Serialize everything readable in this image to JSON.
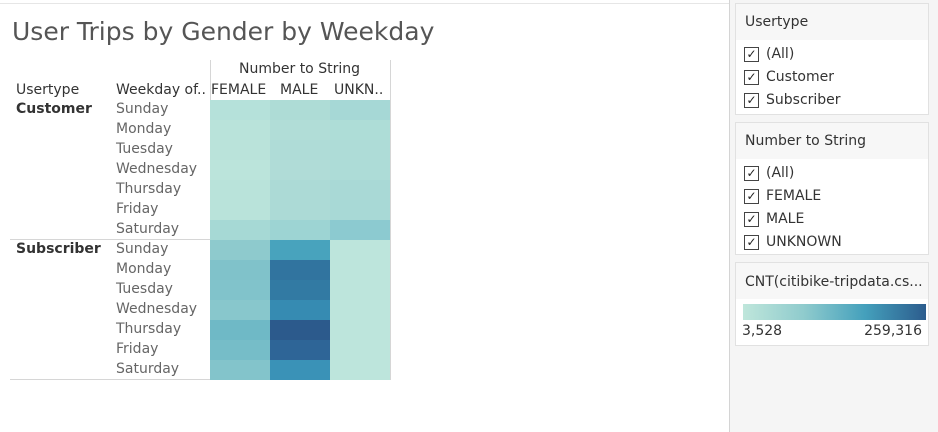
{
  "title": "User Trips by Gender by Weekday",
  "headers": {
    "usertype": "Usertype",
    "weekday": "Weekday of..",
    "number_to_string": "Number to String",
    "columns": [
      "FEMALE",
      "MALE",
      "UNKN.."
    ]
  },
  "groups": [
    {
      "label": "Customer",
      "days": [
        "Sunday",
        "Monday",
        "Tuesday",
        "Wednesday",
        "Thursday",
        "Friday",
        "Saturday"
      ],
      "colors": [
        [
          "#b5e1da",
          "#aedcd6",
          "#a6d8d6"
        ],
        [
          "#b9e3da",
          "#b1ddd7",
          "#aeddd7"
        ],
        [
          "#bae3da",
          "#afdcd7",
          "#aedcd7"
        ],
        [
          "#bbe4db",
          "#b0dcd7",
          "#addcd7"
        ],
        [
          "#b9e3da",
          "#acdad6",
          "#a9d9d6"
        ],
        [
          "#b9e3da",
          "#acdad6",
          "#a8d9d6"
        ],
        [
          "#a6d9d5",
          "#9dd4d3",
          "#8ccad0"
        ]
      ]
    },
    {
      "label": "Subscriber",
      "days": [
        "Sunday",
        "Monday",
        "Tuesday",
        "Wednesday",
        "Thursday",
        "Friday",
        "Saturday"
      ],
      "colors": [
        [
          "#8ecacd",
          "#48a3bd",
          "#bde5dc"
        ],
        [
          "#80c2ca",
          "#31749f",
          "#bde5dc"
        ],
        [
          "#81c3cb",
          "#327aa3",
          "#bde5dc"
        ],
        [
          "#88c7cc",
          "#368bb2",
          "#bde5dc"
        ],
        [
          "#6fb9c6",
          "#2c5a8c",
          "#bde5dc"
        ],
        [
          "#76bdc8",
          "#2e6597",
          "#bde5dc"
        ],
        [
          "#83c4cb",
          "#3a92b7",
          "#bde5dc"
        ]
      ]
    }
  ],
  "filters": {
    "usertype": {
      "title": "Usertype",
      "options": [
        {
          "label": "(All)",
          "checked": true
        },
        {
          "label": "Customer",
          "checked": true
        },
        {
          "label": "Subscriber",
          "checked": true
        }
      ]
    },
    "number_to_string": {
      "title": "Number to String",
      "options": [
        {
          "label": "(All)",
          "checked": true
        },
        {
          "label": "FEMALE",
          "checked": true
        },
        {
          "label": "MALE",
          "checked": true
        },
        {
          "label": "UNKNOWN",
          "checked": true
        }
      ]
    }
  },
  "legend": {
    "title": "CNT(citibike-tripdata.cs...",
    "min": "3,528",
    "max": "259,316",
    "colors": [
      "#bfe6db",
      "#8fcbcd",
      "#44a0bc",
      "#2c5c8d"
    ]
  },
  "check_glyph": "✓"
}
